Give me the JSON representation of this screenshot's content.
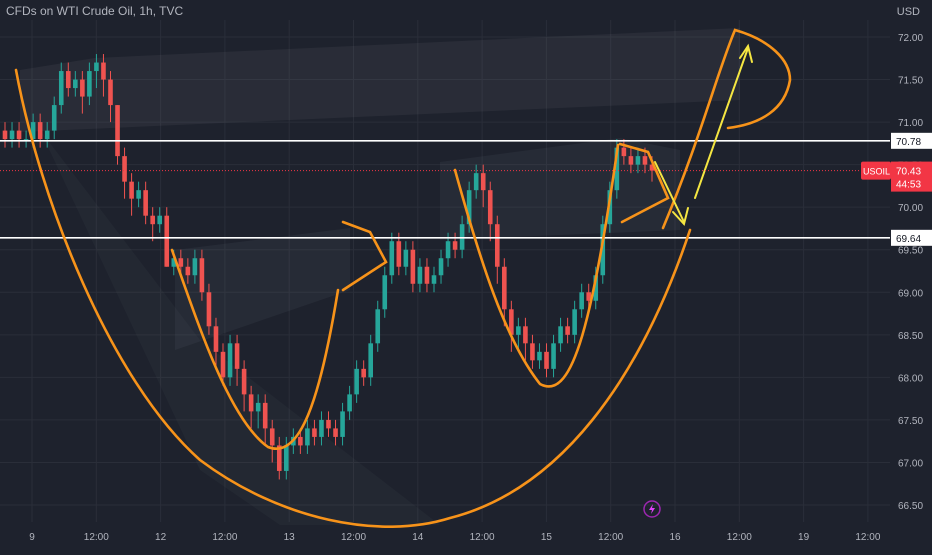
{
  "header": {
    "title": "CFDs on WTI Crude Oil, 1h, TVC",
    "currency": "USD"
  },
  "colors": {
    "background": "#1e222d",
    "up_candle": "#26a69a",
    "down_candle": "#ef5350",
    "drawing": "#f7931a",
    "arrow": "#f5e642",
    "level_line": "#ffffff",
    "current_badge": "#f23645"
  },
  "chart_data": {
    "type": "candlestick",
    "title": "CFDs on WTI Crude Oil, 1h, TVC",
    "x_ticks": [
      "9",
      "12:00",
      "12",
      "12:00",
      "13",
      "12:00",
      "14",
      "12:00",
      "15",
      "12:00",
      "16",
      "12:00",
      "19",
      "12:00"
    ],
    "y_ticks": [
      66.5,
      67.0,
      67.5,
      68.0,
      68.5,
      69.0,
      69.5,
      70.0,
      70.5,
      71.0,
      71.5,
      72.0
    ],
    "ylim": [
      66.3,
      72.2
    ],
    "grid": true,
    "horizontal_levels": [
      {
        "label": "70.78",
        "value": 70.78
      },
      {
        "label": "69.64",
        "value": 69.64
      }
    ],
    "current_price": {
      "symbol": "USOIL",
      "price": "70.43",
      "countdown": "44:53",
      "value": 70.43
    },
    "candles": [
      [
        70.9,
        70.8,
        71.0,
        70.7
      ],
      [
        70.8,
        70.9,
        71.0,
        70.7
      ],
      [
        70.9,
        70.8,
        71.0,
        70.7
      ],
      [
        70.8,
        70.8,
        70.9,
        70.7
      ],
      [
        70.8,
        71.0,
        71.1,
        70.7
      ],
      [
        71.0,
        70.8,
        71.1,
        70.7
      ],
      [
        70.8,
        70.9,
        71.0,
        70.7
      ],
      [
        70.9,
        71.2,
        71.3,
        70.8
      ],
      [
        71.2,
        71.6,
        71.7,
        71.1
      ],
      [
        71.6,
        71.4,
        71.7,
        71.3
      ],
      [
        71.4,
        71.5,
        71.6,
        71.3
      ],
      [
        71.5,
        71.3,
        71.6,
        71.1
      ],
      [
        71.3,
        71.6,
        71.7,
        71.2
      ],
      [
        71.6,
        71.7,
        71.8,
        71.4
      ],
      [
        71.7,
        71.5,
        71.8,
        71.3
      ],
      [
        71.5,
        71.2,
        71.6,
        71.0
      ],
      [
        71.2,
        70.6,
        71.2,
        70.5
      ],
      [
        70.6,
        70.3,
        70.7,
        70.1
      ],
      [
        70.3,
        70.1,
        70.4,
        69.9
      ],
      [
        70.1,
        70.2,
        70.3,
        70.0
      ],
      [
        70.2,
        69.9,
        70.3,
        69.8
      ],
      [
        69.9,
        69.8,
        70.0,
        69.6
      ],
      [
        69.8,
        69.9,
        70.0,
        69.7
      ],
      [
        69.9,
        69.3,
        70.0,
        69.3
      ],
      [
        69.3,
        69.4,
        69.5,
        69.2
      ],
      [
        69.4,
        69.3,
        69.5,
        69.2
      ],
      [
        69.3,
        69.2,
        69.4,
        69.1
      ],
      [
        69.2,
        69.4,
        69.5,
        69.1
      ],
      [
        69.4,
        69.0,
        69.5,
        68.9
      ],
      [
        69.0,
        68.6,
        69.1,
        68.5
      ],
      [
        68.6,
        68.3,
        68.7,
        68.1
      ],
      [
        68.3,
        68.0,
        68.4,
        67.9
      ],
      [
        68.0,
        68.4,
        68.5,
        67.9
      ],
      [
        68.4,
        68.1,
        68.5,
        67.9
      ],
      [
        68.1,
        67.8,
        68.2,
        67.6
      ],
      [
        67.8,
        67.6,
        67.9,
        67.4
      ],
      [
        67.6,
        67.7,
        67.8,
        67.4
      ],
      [
        67.7,
        67.4,
        67.8,
        67.2
      ],
      [
        67.4,
        67.2,
        67.5,
        67.0
      ],
      [
        67.2,
        66.9,
        67.3,
        66.8
      ],
      [
        66.9,
        67.2,
        67.3,
        66.8
      ],
      [
        67.2,
        67.3,
        67.4,
        67.1
      ],
      [
        67.3,
        67.2,
        67.4,
        67.1
      ],
      [
        67.2,
        67.4,
        67.5,
        67.1
      ],
      [
        67.4,
        67.3,
        67.5,
        67.2
      ],
      [
        67.3,
        67.5,
        67.6,
        67.2
      ],
      [
        67.5,
        67.4,
        67.6,
        67.3
      ],
      [
        67.4,
        67.3,
        67.5,
        67.2
      ],
      [
        67.3,
        67.6,
        67.7,
        67.2
      ],
      [
        67.6,
        67.8,
        67.9,
        67.5
      ],
      [
        67.8,
        68.1,
        68.2,
        67.7
      ],
      [
        68.1,
        68.0,
        68.2,
        67.9
      ],
      [
        68.0,
        68.4,
        68.5,
        67.9
      ],
      [
        68.4,
        68.8,
        68.9,
        68.3
      ],
      [
        68.8,
        69.2,
        69.3,
        68.7
      ],
      [
        69.2,
        69.6,
        69.7,
        69.1
      ],
      [
        69.6,
        69.3,
        69.7,
        69.2
      ],
      [
        69.3,
        69.5,
        69.6,
        69.2
      ],
      [
        69.5,
        69.1,
        69.6,
        69.0
      ],
      [
        69.1,
        69.3,
        69.4,
        69.0
      ],
      [
        69.3,
        69.1,
        69.4,
        69.0
      ],
      [
        69.1,
        69.2,
        69.3,
        69.0
      ],
      [
        69.2,
        69.4,
        69.5,
        69.1
      ],
      [
        69.4,
        69.6,
        69.7,
        69.3
      ],
      [
        69.6,
        69.5,
        69.7,
        69.4
      ],
      [
        69.5,
        69.8,
        69.9,
        69.4
      ],
      [
        69.8,
        70.2,
        70.3,
        69.7
      ],
      [
        70.2,
        70.4,
        70.5,
        70.1
      ],
      [
        70.4,
        70.2,
        70.5,
        70.0
      ],
      [
        70.2,
        69.8,
        70.3,
        69.6
      ],
      [
        69.8,
        69.3,
        69.9,
        69.1
      ],
      [
        69.3,
        68.8,
        69.4,
        68.6
      ],
      [
        68.8,
        68.5,
        68.9,
        68.3
      ],
      [
        68.5,
        68.6,
        68.7,
        68.3
      ],
      [
        68.6,
        68.4,
        68.7,
        68.2
      ],
      [
        68.4,
        68.2,
        68.5,
        68.1
      ],
      [
        68.2,
        68.3,
        68.4,
        68.1
      ],
      [
        68.3,
        68.1,
        68.4,
        68.0
      ],
      [
        68.1,
        68.4,
        68.5,
        68.0
      ],
      [
        68.4,
        68.6,
        68.7,
        68.3
      ],
      [
        68.6,
        68.5,
        68.7,
        68.4
      ],
      [
        68.5,
        68.8,
        68.9,
        68.4
      ],
      [
        68.8,
        69.0,
        69.1,
        68.7
      ],
      [
        69.0,
        68.9,
        69.1,
        68.8
      ],
      [
        68.9,
        69.2,
        69.3,
        68.8
      ],
      [
        69.2,
        69.8,
        69.9,
        69.1
      ],
      [
        69.8,
        70.2,
        70.3,
        69.7
      ],
      [
        70.2,
        70.7,
        70.8,
        70.1
      ],
      [
        70.7,
        70.6,
        70.8,
        70.5
      ],
      [
        70.6,
        70.5,
        70.7,
        70.4
      ],
      [
        70.5,
        70.6,
        70.7,
        70.4
      ],
      [
        70.6,
        70.5,
        70.7,
        70.4
      ],
      [
        70.5,
        70.43,
        70.6,
        70.3
      ]
    ]
  },
  "footer": {
    "event_icon": "lightning-icon"
  }
}
